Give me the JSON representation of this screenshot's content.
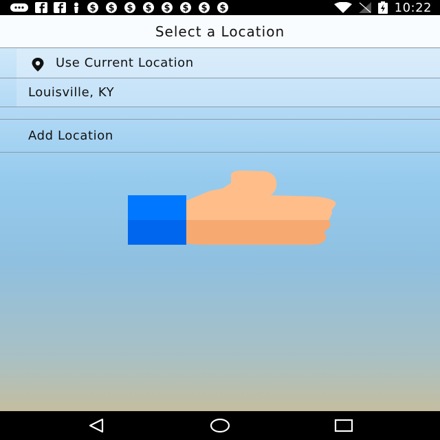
{
  "status_bar": {
    "time": "10:22",
    "notification_icons": [
      "message-icon",
      "facebook-icon",
      "facebook-icon",
      "person-icon",
      "dollar-icon",
      "dollar-icon",
      "dollar-icon",
      "dollar-icon",
      "dollar-icon",
      "dollar-icon",
      "dollar-icon",
      "dollar-icon"
    ],
    "system_icons": [
      "wifi-icon",
      "signal-icon",
      "battery-charging-icon"
    ]
  },
  "header": {
    "title": "Select a Location"
  },
  "locations": {
    "current_location_label": "Use Current Location",
    "saved": [
      "Louisville, KY"
    ],
    "add_label": "Add Location"
  },
  "illustration": {
    "icon": "thumbs-up-icon",
    "colors": {
      "cuff": "#0066ff",
      "skin": "#ffbb88"
    }
  },
  "nav_bar": {
    "icons": [
      "back-icon",
      "home-icon",
      "recents-icon"
    ]
  },
  "colors": {
    "status_bar": "#000000",
    "title_bar": "#f9fcfe",
    "nav_bar": "#000000"
  }
}
